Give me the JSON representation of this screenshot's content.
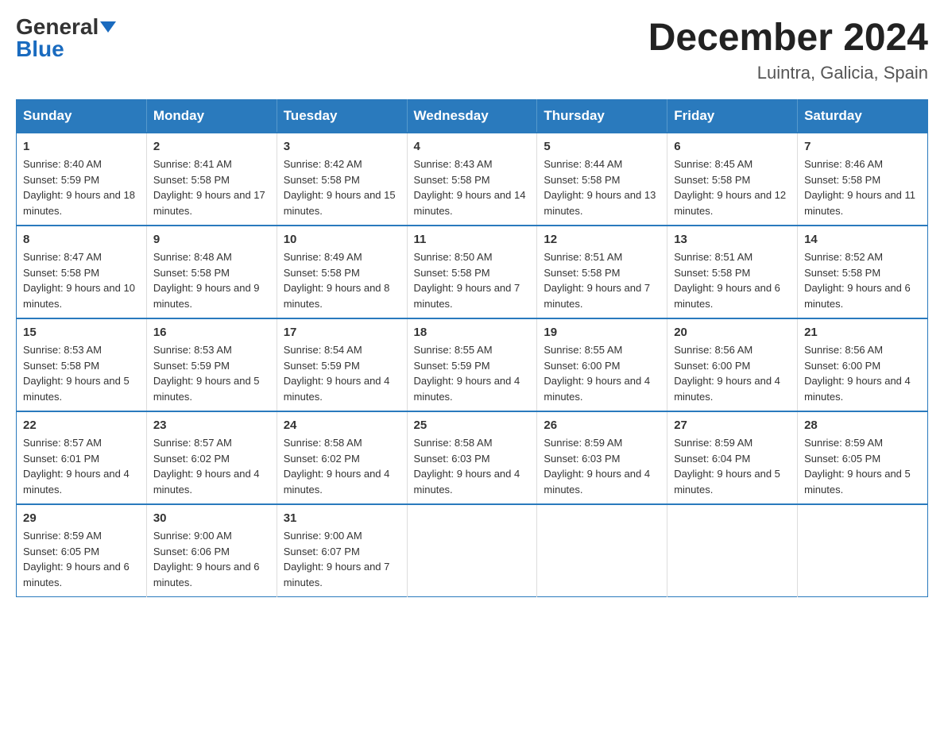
{
  "logo": {
    "general": "General",
    "blue": "Blue"
  },
  "title": "December 2024",
  "location": "Luintra, Galicia, Spain",
  "days_of_week": [
    "Sunday",
    "Monday",
    "Tuesday",
    "Wednesday",
    "Thursday",
    "Friday",
    "Saturday"
  ],
  "weeks": [
    [
      {
        "day": "1",
        "sunrise": "8:40 AM",
        "sunset": "5:59 PM",
        "daylight": "9 hours and 18 minutes."
      },
      {
        "day": "2",
        "sunrise": "8:41 AM",
        "sunset": "5:58 PM",
        "daylight": "9 hours and 17 minutes."
      },
      {
        "day": "3",
        "sunrise": "8:42 AM",
        "sunset": "5:58 PM",
        "daylight": "9 hours and 15 minutes."
      },
      {
        "day": "4",
        "sunrise": "8:43 AM",
        "sunset": "5:58 PM",
        "daylight": "9 hours and 14 minutes."
      },
      {
        "day": "5",
        "sunrise": "8:44 AM",
        "sunset": "5:58 PM",
        "daylight": "9 hours and 13 minutes."
      },
      {
        "day": "6",
        "sunrise": "8:45 AM",
        "sunset": "5:58 PM",
        "daylight": "9 hours and 12 minutes."
      },
      {
        "day": "7",
        "sunrise": "8:46 AM",
        "sunset": "5:58 PM",
        "daylight": "9 hours and 11 minutes."
      }
    ],
    [
      {
        "day": "8",
        "sunrise": "8:47 AM",
        "sunset": "5:58 PM",
        "daylight": "9 hours and 10 minutes."
      },
      {
        "day": "9",
        "sunrise": "8:48 AM",
        "sunset": "5:58 PM",
        "daylight": "9 hours and 9 minutes."
      },
      {
        "day": "10",
        "sunrise": "8:49 AM",
        "sunset": "5:58 PM",
        "daylight": "9 hours and 8 minutes."
      },
      {
        "day": "11",
        "sunrise": "8:50 AM",
        "sunset": "5:58 PM",
        "daylight": "9 hours and 7 minutes."
      },
      {
        "day": "12",
        "sunrise": "8:51 AM",
        "sunset": "5:58 PM",
        "daylight": "9 hours and 7 minutes."
      },
      {
        "day": "13",
        "sunrise": "8:51 AM",
        "sunset": "5:58 PM",
        "daylight": "9 hours and 6 minutes."
      },
      {
        "day": "14",
        "sunrise": "8:52 AM",
        "sunset": "5:58 PM",
        "daylight": "9 hours and 6 minutes."
      }
    ],
    [
      {
        "day": "15",
        "sunrise": "8:53 AM",
        "sunset": "5:58 PM",
        "daylight": "9 hours and 5 minutes."
      },
      {
        "day": "16",
        "sunrise": "8:53 AM",
        "sunset": "5:59 PM",
        "daylight": "9 hours and 5 minutes."
      },
      {
        "day": "17",
        "sunrise": "8:54 AM",
        "sunset": "5:59 PM",
        "daylight": "9 hours and 4 minutes."
      },
      {
        "day": "18",
        "sunrise": "8:55 AM",
        "sunset": "5:59 PM",
        "daylight": "9 hours and 4 minutes."
      },
      {
        "day": "19",
        "sunrise": "8:55 AM",
        "sunset": "6:00 PM",
        "daylight": "9 hours and 4 minutes."
      },
      {
        "day": "20",
        "sunrise": "8:56 AM",
        "sunset": "6:00 PM",
        "daylight": "9 hours and 4 minutes."
      },
      {
        "day": "21",
        "sunrise": "8:56 AM",
        "sunset": "6:00 PM",
        "daylight": "9 hours and 4 minutes."
      }
    ],
    [
      {
        "day": "22",
        "sunrise": "8:57 AM",
        "sunset": "6:01 PM",
        "daylight": "9 hours and 4 minutes."
      },
      {
        "day": "23",
        "sunrise": "8:57 AM",
        "sunset": "6:02 PM",
        "daylight": "9 hours and 4 minutes."
      },
      {
        "day": "24",
        "sunrise": "8:58 AM",
        "sunset": "6:02 PM",
        "daylight": "9 hours and 4 minutes."
      },
      {
        "day": "25",
        "sunrise": "8:58 AM",
        "sunset": "6:03 PM",
        "daylight": "9 hours and 4 minutes."
      },
      {
        "day": "26",
        "sunrise": "8:59 AM",
        "sunset": "6:03 PM",
        "daylight": "9 hours and 4 minutes."
      },
      {
        "day": "27",
        "sunrise": "8:59 AM",
        "sunset": "6:04 PM",
        "daylight": "9 hours and 5 minutes."
      },
      {
        "day": "28",
        "sunrise": "8:59 AM",
        "sunset": "6:05 PM",
        "daylight": "9 hours and 5 minutes."
      }
    ],
    [
      {
        "day": "29",
        "sunrise": "8:59 AM",
        "sunset": "6:05 PM",
        "daylight": "9 hours and 6 minutes."
      },
      {
        "day": "30",
        "sunrise": "9:00 AM",
        "sunset": "6:06 PM",
        "daylight": "9 hours and 6 minutes."
      },
      {
        "day": "31",
        "sunrise": "9:00 AM",
        "sunset": "6:07 PM",
        "daylight": "9 hours and 7 minutes."
      },
      null,
      null,
      null,
      null
    ]
  ],
  "labels": {
    "sunrise": "Sunrise:",
    "sunset": "Sunset:",
    "daylight": "Daylight:"
  }
}
